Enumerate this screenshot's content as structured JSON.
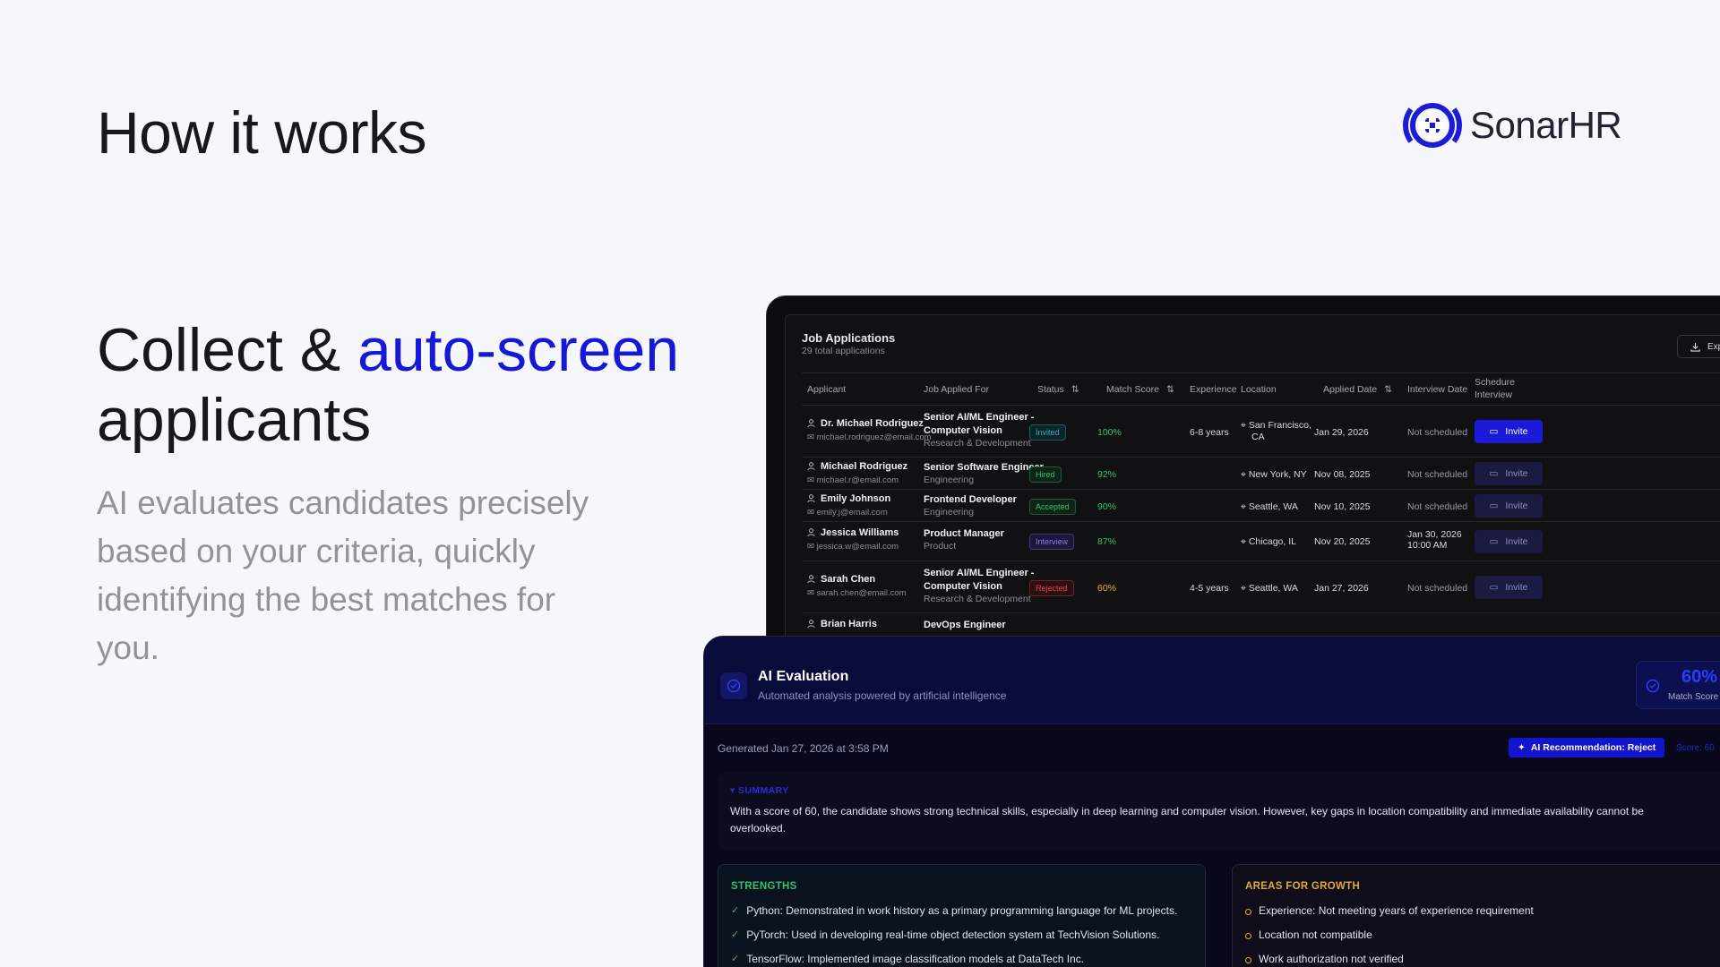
{
  "page": {
    "heading": "How it works",
    "logo_text": "SonarHR",
    "headline_part1": "Collect & ",
    "headline_accent": "auto-screen",
    "headline_part2": "applicants",
    "description": "AI evaluates candidates precisely based on your criteria, quickly identifying the best matches for you.",
    "colors": {
      "accent": "#1717d6",
      "background": "#f6f7fb",
      "desc_text": "#8f939c"
    }
  },
  "job_applications": {
    "title": "Job Applications",
    "subtitle": "29 total applications",
    "export_label": "Exp",
    "columns": {
      "applicant": "Applicant",
      "job": "Job Applied For",
      "status": "Status",
      "match": "Match Score",
      "experience": "Experience",
      "location": "Location",
      "applied": "Applied Date",
      "interview": "Interview Date",
      "schedule_1": "Schedure",
      "schedule_2": "Interview"
    },
    "rows": [
      {
        "name": "Dr. Michael Rodriguez",
        "email": "michael.rodriguez@email.com",
        "role_1": "Senior AI/ML Engineer -",
        "role_2": "Computer Vision",
        "dept": "Research & Development",
        "status": "Invited",
        "score": "100%",
        "experience": "6-8 years",
        "location_1": "San Francisco,",
        "location_2": "CA",
        "applied": "Jan 29, 2026",
        "interview_1": "Not scheduled",
        "interview_2": "",
        "invite": "Invite"
      },
      {
        "name": "Michael Rodriguez",
        "email": "michael.r@email.com",
        "role_1": "Senior Software Engineer",
        "role_2": "",
        "dept": "Engineering",
        "status": "Hired",
        "score": "92%",
        "experience": "",
        "location_1": "New York, NY",
        "location_2": "",
        "applied": "Nov 08, 2025",
        "interview_1": "Not scheduled",
        "interview_2": "",
        "invite": "Invite"
      },
      {
        "name": "Emily Johnson",
        "email": "emily.j@email.com",
        "role_1": "Frontend Developer",
        "role_2": "",
        "dept": "Engineering",
        "status": "Accepted",
        "score": "90%",
        "experience": "",
        "location_1": "Seattle, WA",
        "location_2": "",
        "applied": "Nov 10, 2025",
        "interview_1": "Not scheduled",
        "interview_2": "",
        "invite": "Invite"
      },
      {
        "name": "Jessica Williams",
        "email": "jessica.w@email.com",
        "role_1": "Product Manager",
        "role_2": "",
        "dept": "Product",
        "status": "Interview",
        "score": "87%",
        "experience": "",
        "location_1": "Chicago, IL",
        "location_2": "",
        "applied": "Nov 20, 2025",
        "interview_1": "Jan 30, 2026",
        "interview_2": "10:00 AM",
        "invite": "Invite"
      },
      {
        "name": "Sarah Chen",
        "email": "sarah.chen@email.com",
        "role_1": "Senior AI/ML Engineer -",
        "role_2": "Computer Vision",
        "dept": "Research & Development",
        "status": "Rejected",
        "score": "60%",
        "experience": "4-5 years",
        "location_1": "Seattle, WA",
        "location_2": "",
        "applied": "Jan 27, 2026",
        "interview_1": "Not scheduled",
        "interview_2": "",
        "invite": "Invite"
      },
      {
        "name": "Brian Harris",
        "email": "",
        "role_1": "DevOps Engineer",
        "role_2": "",
        "dept": "",
        "status": "",
        "score": "",
        "experience": "",
        "location_1": "",
        "location_2": "",
        "applied": "",
        "interview_1": "",
        "interview_2": "",
        "invite": ""
      }
    ]
  },
  "ai_evaluation": {
    "title": "AI Evaluation",
    "subtitle": "Automated analysis powered by artificial intelligence",
    "match_value": "60%",
    "match_label": "Match Score",
    "generated": "Generated Jan 27, 2026 at 3:58 PM",
    "recommendation": "AI Recommendation: Reject",
    "score_text": "Score: 60",
    "summary_label": "SUMMARY",
    "summary_text": "With a score of 60, the candidate shows strong technical skills, especially in deep learning and computer vision. However, key gaps in location compatibility and immediate availability cannot be overlooked.",
    "strengths_title": "STRENGTHS",
    "strengths": [
      "Python: Demonstrated in work history as a primary programming language for ML projects.",
      "PyTorch: Used in developing real-time object detection system at TechVision Solutions.",
      "TensorFlow: Implemented image classification models at DataTech Inc."
    ],
    "growth_title": "AREAS FOR GROWTH",
    "growth": [
      "Experience: Not meeting years of experience requirement",
      "Location not compatible",
      "Work authorization not verified"
    ]
  }
}
